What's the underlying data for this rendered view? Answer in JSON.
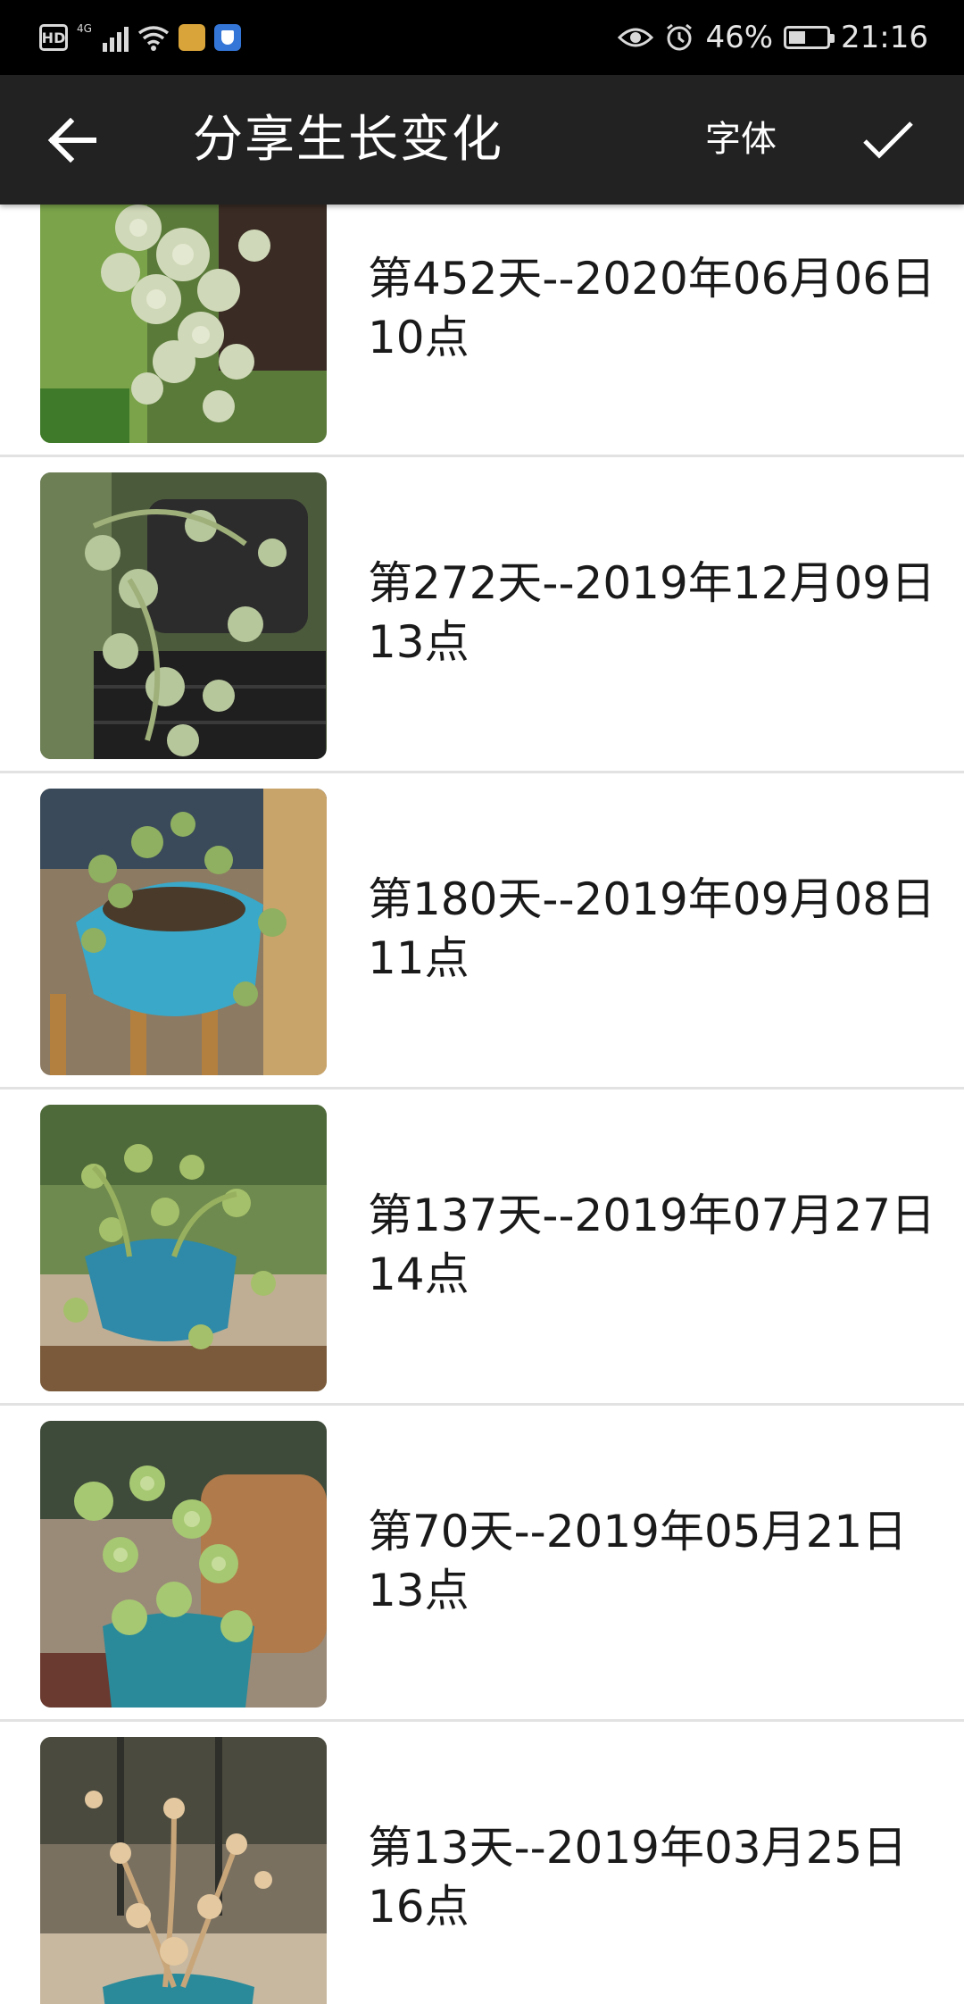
{
  "status_bar": {
    "hd_badge": "HD",
    "network_label": "4G",
    "battery_percent": "46%",
    "battery_level": 0.46,
    "time": "21:16",
    "icons": [
      "hd-icon",
      "signal-icon",
      "wifi-icon",
      "app-notification-icon",
      "shield-app-icon",
      "eye-icon",
      "alarm-icon",
      "battery-icon"
    ]
  },
  "app_bar": {
    "title": "分享生长变化",
    "font_label": "字体",
    "back_icon": "back-arrow-icon",
    "confirm_icon": "check-icon"
  },
  "entries": [
    {
      "date_line": "第452天--2020年06月06日",
      "hour_line": "10点",
      "photo": "succulent-photo"
    },
    {
      "date_line": "第272天--2019年12月09日",
      "hour_line": "13点",
      "photo": "succulent-photo"
    },
    {
      "date_line": "第180天--2019年09月08日",
      "hour_line": "11点",
      "photo": "succulent-photo"
    },
    {
      "date_line": "第137天--2019年07月27日",
      "hour_line": "14点",
      "photo": "succulent-photo"
    },
    {
      "date_line": "第70天--2019年05月21日",
      "hour_line": "13点",
      "photo": "succulent-photo"
    },
    {
      "date_line": "第13天--2019年03月25日",
      "hour_line": "16点",
      "photo": "succulent-photo"
    }
  ]
}
